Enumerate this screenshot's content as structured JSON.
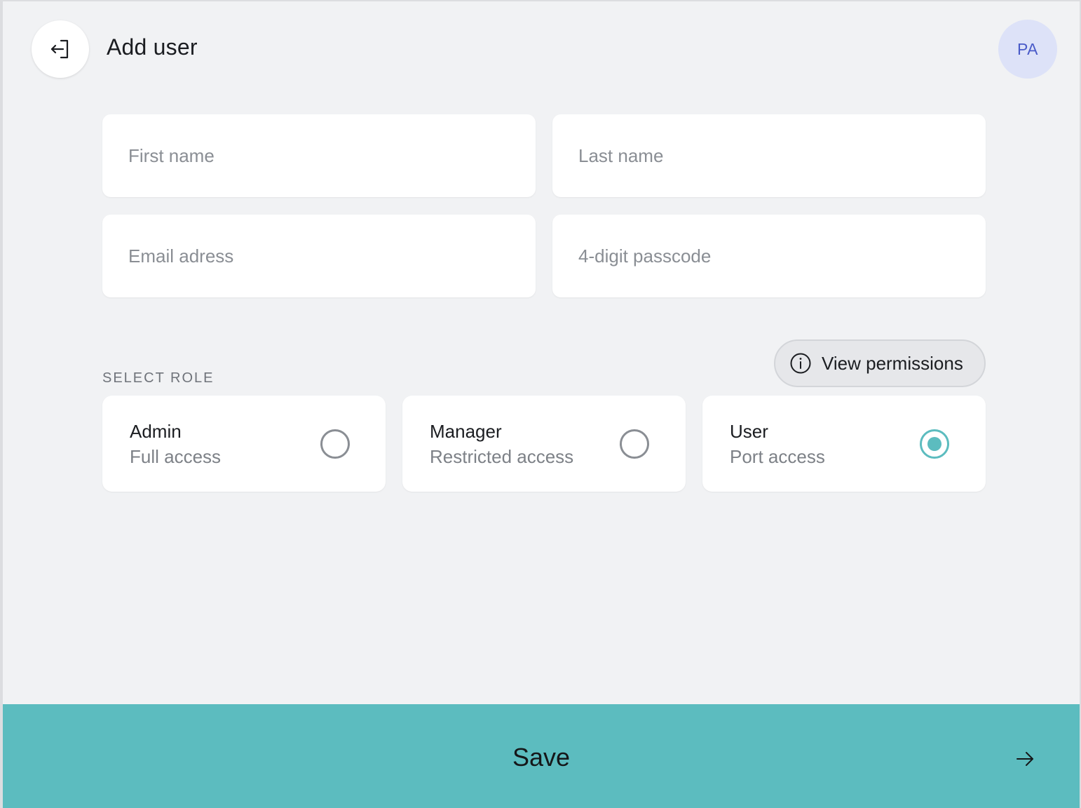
{
  "header": {
    "back_icon": "exit-icon",
    "title": "Add user",
    "avatar_initials": "PA"
  },
  "form": {
    "first_name": {
      "placeholder": "First name",
      "value": ""
    },
    "last_name": {
      "placeholder": "Last name",
      "value": ""
    },
    "email": {
      "placeholder": "Email adress",
      "value": ""
    },
    "passcode": {
      "placeholder": "4-digit passcode",
      "value": ""
    }
  },
  "roles": {
    "section_label": "SELECT ROLE",
    "view_permissions_label": "View permissions",
    "view_permissions_icon": "info-icon",
    "options": [
      {
        "name": "Admin",
        "description": "Full access",
        "selected": false
      },
      {
        "name": "Manager",
        "description": "Restricted access",
        "selected": false
      },
      {
        "name": "User",
        "description": "Port access",
        "selected": true
      }
    ]
  },
  "footer": {
    "save_label": "Save",
    "arrow_icon": "arrow-right-icon"
  },
  "colors": {
    "accent": "#5cbcbf",
    "background": "#f1f2f4",
    "avatar_bg": "#dde2f8",
    "avatar_text": "#4a5bc8"
  }
}
